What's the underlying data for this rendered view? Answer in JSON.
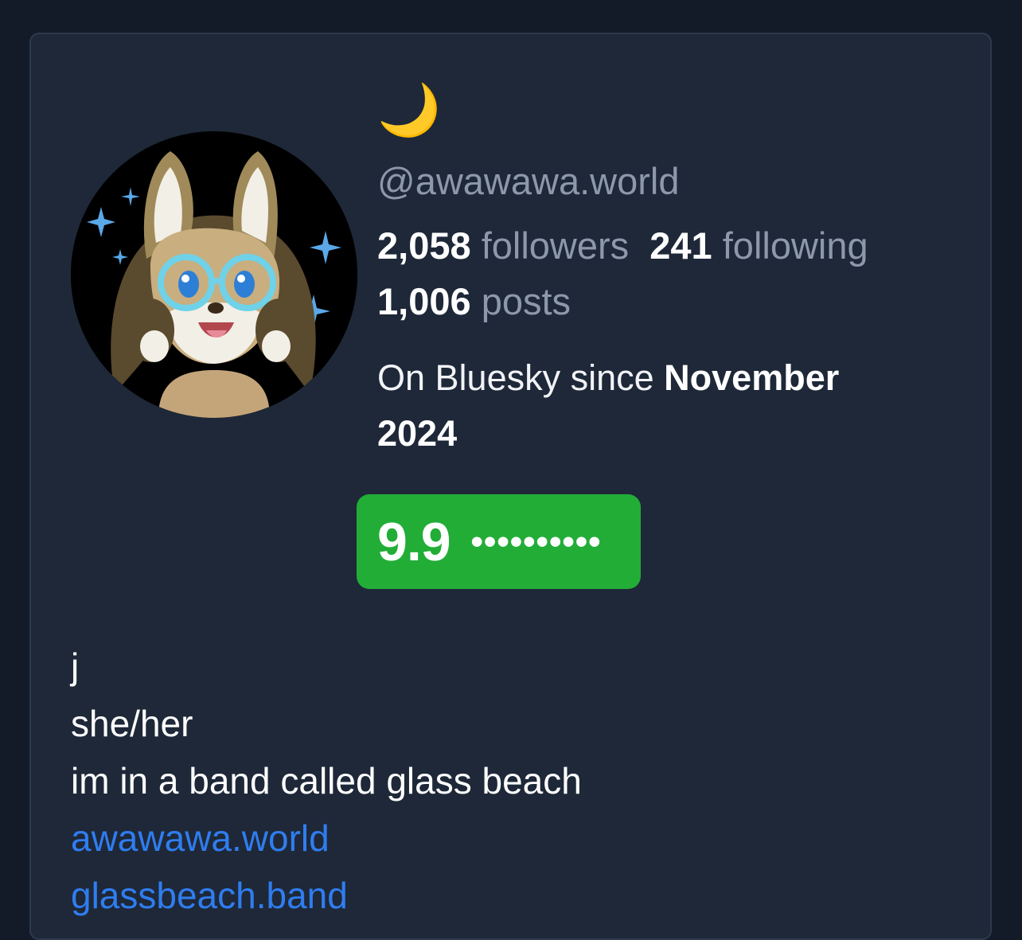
{
  "profile": {
    "display_name": "🌙",
    "handle": "@awawawa.world",
    "avatar_icon": "fox-character-avatar"
  },
  "stats": {
    "followers_count": "2,058",
    "followers_label": "followers",
    "following_count": "241",
    "following_label": "following",
    "posts_count": "1,006",
    "posts_label": "posts"
  },
  "since": {
    "prefix": "On Bluesky since",
    "date": "November 2024"
  },
  "score": {
    "value": "9.9",
    "dots": "••••••••••",
    "color": "#22ad37"
  },
  "bio": {
    "lines": [
      "j",
      "she/her",
      "im in a band called glass beach"
    ],
    "links": [
      "awawawa.world",
      "glassbeach.band"
    ],
    "link_color": "#2f7df0"
  }
}
